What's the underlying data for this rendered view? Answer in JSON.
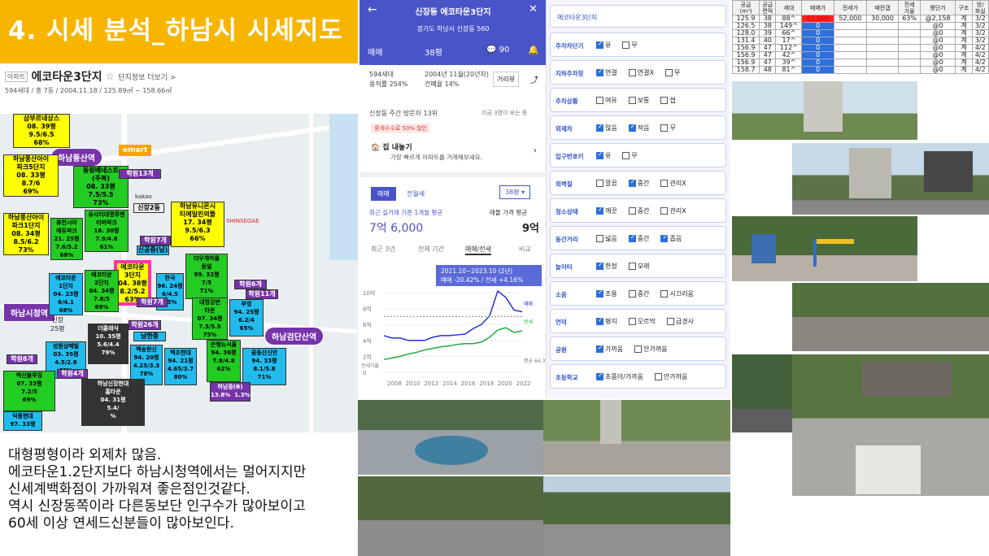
{
  "title": "4. 시세 분석_하남시 시세지도",
  "apt": {
    "tag": "아파트",
    "name": "에코타운3단지",
    "star": "☆",
    "more": "단지정보 더보기 >",
    "meta": "594세대 / 총 7동 / 2004.11.18 / 125.89㎡ ~ 158.66㎡"
  },
  "map": {
    "stations": [
      "하남풍산역",
      "하남검단산역",
      "하남시청역"
    ],
    "emart": "emart",
    "kakao": "kakao",
    "shinsegae": "SHINSEGAE",
    "labels": [
      {
        "t": "삼부르네상스\n08. 39평\n9.5/6.5\n68%"
      },
      {
        "t": "하남풍산아이\n파크5단지\n08. 33평\n8.7/6\n69%"
      },
      {
        "t": "동원베네스트\n(주복)\n08. 33평\n7.5/5.5\n73%"
      },
      {
        "t": "하남풍산아이\n파크1단지\n08. 34평\n8.5/6.2\n73%"
      },
      {
        "t": "휴먼시아\n에듀파크\n21. 25평\n7.6/5.2\n68%"
      },
      {
        "t": "유사티대명루젠\n리버파크\n18. 30평\n7.9/4.8\n61%"
      },
      {
        "t": "하남유니온시\n티에일린의뜰\n17. 34평\n9.5/6.3\n66%"
      },
      {
        "t": "에코타운\n3단지\n04. 38평\n8.2/5.2\n63%"
      },
      {
        "t": "에코타운\n2단지\n04. 34평\n7.8/5\n69%"
      },
      {
        "t": "에코타운\n1단지\n04. 23평\n6/4.1\n68%"
      },
      {
        "t": "한국\n96. 24평\n6/4.5\n75%"
      },
      {
        "t": "더우개마을\n동일\n99. 32평\n7/5\n71%"
      },
      {
        "t": "대명강변\n타운\n07. 34평\n7.3/5.5\n75%"
      },
      {
        "t": "부영\n94. 25평\n6.2/4\n65%"
      },
      {
        "t": "더클래식\n10. 35평\n5.6/4.4\n79%"
      },
      {
        "t": "성원상떼빌\n03. 35평\n4.5/2.8\n62%"
      },
      {
        "t": "백송한신\n94. 20평\n4.25/3.3\n78%"
      },
      {
        "t": "백조현대\n94. 21평\n4.65/3.7\n80%"
      },
      {
        "t": "은행뉴서울\n94. 38평\n7.8/4.8\n62%"
      },
      {
        "t": "꿈동산신안\n94. 33평\n8.1/5.8\n71%"
      },
      {
        "t": "백산블루밍\n07. 33평\n7.2/5\n69%"
      },
      {
        "t": "하남신장현대\n홈타운\n04. 31평\n5.4/\n%"
      },
      {
        "t": "덕풍현대\n97. 33평"
      },
      {
        "t": "신장\n25평"
      },
      {
        "t": "하남중(B)\n13.8%  1.3%"
      }
    ],
    "school": [
      "학원13개",
      "학원7개",
      "학원7개",
      "학원6개",
      "학원11개",
      "학원26개",
      "학원8개",
      "학원4개",
      "신장2동",
      "남한중",
      "신공중(남)"
    ]
  },
  "memo": [
    "대형평형이라 외제차 많음.",
    "에코타운1.2단지보다 하남시청역에서는 멀어지지만",
    "신세계백화점이 가까워져 좋은점인것같다.",
    "역시 신장동쪽이라 다른동보단 인구수가 많아보이고",
    "60세 이상 연세드신분들이 많아보인다."
  ],
  "phone": {
    "title": "신장동 에코타운3단지",
    "addr": "경기도 하남시 신장동 560",
    "deal": "매매",
    "size": "38평",
    "comments": "90",
    "hh": "594세대",
    "rate": "용적률 254%",
    "date": "2004년 11월(20년차)",
    "bldg": "건폐율 14%",
    "road": "거리뷰",
    "visit": "신장동 주간 방문자 13위",
    "visit2": "지금 3명이 보는 중",
    "fee": "중개수수료 50% 할인",
    "sell": "집 내놓기",
    "sell2": "가장 빠르게 아파트를 거래해보세요.",
    "tab1": "매매",
    "tab2": "전월세",
    "sel": "38평",
    "recent": "최근 실거래 기준 1개월 평균",
    "price": "7억 6,000",
    "ask": "매물 가격 평균",
    "askv": "9억",
    "tabs": [
      "최근 3년",
      "전체 기간",
      "매매/전세",
      "비교"
    ],
    "tip1": "2021.10~2023.10 (2년)",
    "tip2": "매매 -20.42% / 전세 +4.16%",
    "y": [
      "10억",
      "8억",
      "6억",
      "4억",
      "2억",
      "0"
    ],
    "x": [
      "2008",
      "2010",
      "2012",
      "2014",
      "2016",
      "2018",
      "2020",
      "2022"
    ],
    "leg": [
      "매매",
      "전세",
      "평균\n64.3%"
    ],
    "jl": "전세가율"
  },
  "checklist": {
    "header": "에코타운3단지",
    "rows": [
      {
        "k": "주차차단기",
        "o": [
          "유",
          "무"
        ],
        "on": [
          0
        ]
      },
      {
        "k": "지하주차장",
        "o": [
          "연결",
          "연결X",
          "무"
        ],
        "on": [
          0
        ]
      },
      {
        "k": "주차상황",
        "o": [
          "여유",
          "보통",
          "협"
        ],
        "on": []
      },
      {
        "k": "외제차",
        "o": [
          "많음",
          "적음",
          "무"
        ],
        "on": [
          0,
          1
        ]
      },
      {
        "k": "입구번호키",
        "o": [
          "유",
          "무"
        ],
        "on": [
          0
        ]
      },
      {
        "k": "외벽칠",
        "o": [
          "깔끔",
          "중간",
          "관리X"
        ],
        "on": [
          1
        ]
      },
      {
        "k": "청소상태",
        "o": [
          "깨끗",
          "중간",
          "관리X"
        ],
        "on": [
          0
        ]
      },
      {
        "k": "동간거리",
        "o": [
          "넓음",
          "중간",
          "좁음"
        ],
        "on": [
          1,
          2
        ]
      },
      {
        "k": "놀이터",
        "o": [
          "한정",
          "모래"
        ],
        "on": [
          0
        ]
      },
      {
        "k": "소음",
        "o": [
          "조용",
          "중간",
          "시끄러움"
        ],
        "on": [
          0
        ]
      },
      {
        "k": "언덕",
        "o": [
          "평지",
          "오르막",
          "급경사"
        ],
        "on": [
          0
        ]
      },
      {
        "k": "공원",
        "o": [
          "가까움",
          "안가까움"
        ],
        "on": [
          0
        ]
      },
      {
        "k": "초등학교",
        "o": [
          "초품아/가까움",
          "안가까움"
        ],
        "on": [
          0
        ]
      }
    ]
  },
  "table": {
    "head": [
      "공급\n(m²)",
      "공급\n면적",
      "세대",
      "매매가",
      "전세가",
      "매전갭",
      "전세\n가율",
      "평단가",
      "구조",
      "방/\n화실"
    ],
    "rows": [
      [
        "125.9",
        "38",
        "88^",
        "82,000",
        "52,000",
        "30,000",
        "63%",
        "@2,158",
        "계",
        "3/2"
      ],
      [
        "126.5",
        "38",
        "149^",
        "0",
        "",
        "",
        "",
        "@0",
        "계",
        "3/2"
      ],
      [
        "128.0",
        "39",
        "66^",
        "0",
        "",
        "",
        "",
        "@0",
        "계",
        "3/2"
      ],
      [
        "131.4",
        "40",
        "17^",
        "0",
        "",
        "",
        "",
        "@0",
        "계",
        "3/2"
      ],
      [
        "156.9",
        "47",
        "112^",
        "0",
        "",
        "",
        "",
        "@0",
        "계",
        "4/2"
      ],
      [
        "156.9",
        "47",
        "42^",
        "0",
        "",
        "",
        "",
        "@0",
        "계",
        "4/2"
      ],
      [
        "156.9",
        "47",
        "39^",
        "0",
        "",
        "",
        "",
        "@0",
        "계",
        "4/2"
      ],
      [
        "158.7",
        "48",
        "81^",
        "0",
        "",
        "",
        "",
        "@0",
        "계",
        "4/2"
      ]
    ]
  },
  "colors": {
    "title_bg": "#f7b500",
    "phone_hdr": "#4a54c9",
    "station": "#7733aa",
    "highlight": "#ff2222",
    "sale": "#2233cc",
    "jeonse": "#22aa44"
  }
}
